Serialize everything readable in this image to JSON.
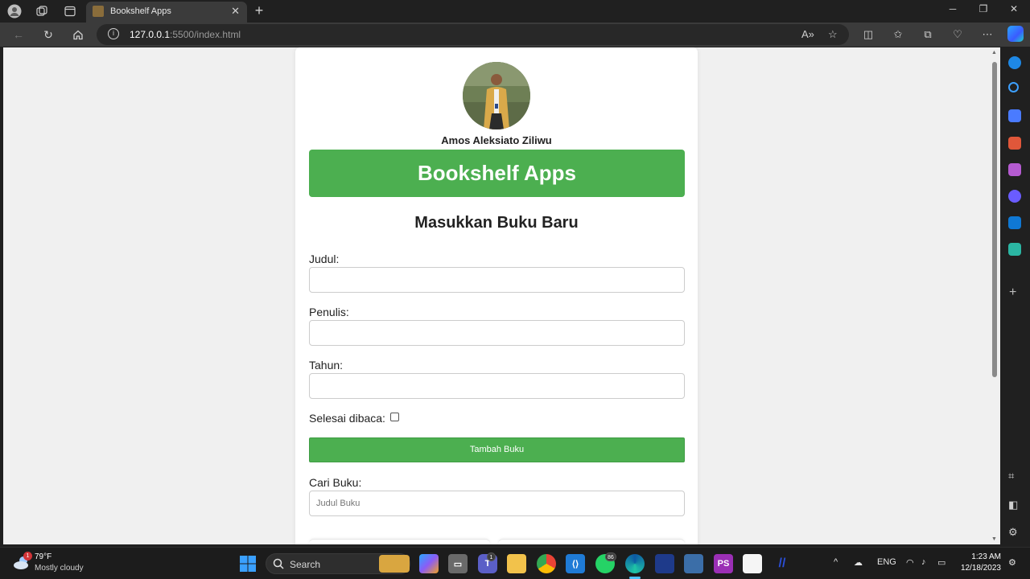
{
  "browser": {
    "tab_title": "Bookshelf Apps",
    "url_host": "127.0.0.1",
    "url_rest": ":5500/index.html"
  },
  "page": {
    "author_name": "Amos Aleksiato Ziliwu",
    "app_title": "Bookshelf Apps",
    "form_heading": "Masukkan Buku Baru",
    "title_label": "Judul:",
    "title_value": "",
    "author_label": "Penulis:",
    "author_value": "",
    "year_label": "Tahun:",
    "year_value": "",
    "finished_label": "Selesai dibaca:",
    "finished_checked": false,
    "add_button": "Tambah Buku",
    "search_label": "Cari Buku:",
    "search_placeholder": "Judul Buku"
  },
  "taskbar": {
    "weather_temp": "79°F",
    "weather_desc": "Mostly cloudy",
    "weather_badge": "1",
    "search_label": "Search",
    "teams_badge": "1",
    "whatsapp_badge": "86",
    "language": "ENG",
    "time": "1:23 AM",
    "date": "12/18/2023"
  },
  "colors": {
    "accent_green": "#4caf50",
    "browser_dark": "#202020",
    "page_bg": "#f0f0f0"
  }
}
